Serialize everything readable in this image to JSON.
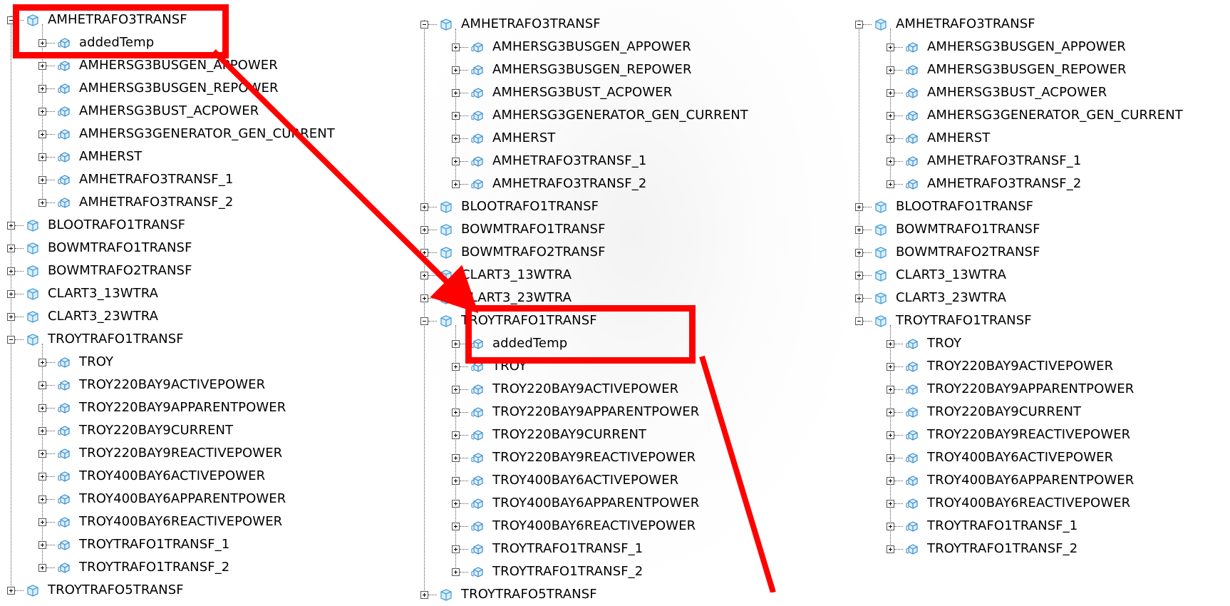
{
  "colors": {
    "highlight": "#ff0000",
    "icon_folder": "#4aa0d8",
    "icon_item": "#3a8ccc"
  },
  "left_panel": {
    "rows": [
      {
        "label": "AMHETRAFO3TRANSF",
        "level": 0,
        "state": "expanded",
        "icon": "cube-folder-icon"
      },
      {
        "label": "addedTemp",
        "level": 1,
        "state": "collapsed",
        "icon": "cube-item-icon"
      },
      {
        "label": "AMHERSG3BUSGEN_APPOWER",
        "level": 1,
        "state": "collapsed",
        "icon": "cube-item-icon"
      },
      {
        "label": "AMHERSG3BUSGEN_REPOWER",
        "level": 1,
        "state": "collapsed",
        "icon": "cube-item-icon"
      },
      {
        "label": "AMHERSG3BUST_ACPOWER",
        "level": 1,
        "state": "collapsed",
        "icon": "cube-item-icon"
      },
      {
        "label": "AMHERSG3GENERATOR_GEN_CURRENT",
        "level": 1,
        "state": "collapsed",
        "icon": "cube-item-icon"
      },
      {
        "label": "AMHERST",
        "level": 1,
        "state": "collapsed",
        "icon": "cube-item-icon"
      },
      {
        "label": "AMHETRAFO3TRANSF_1",
        "level": 1,
        "state": "collapsed",
        "icon": "cube-item-icon"
      },
      {
        "label": "AMHETRAFO3TRANSF_2",
        "level": 1,
        "state": "collapsed",
        "icon": "cube-item-icon"
      },
      {
        "label": "BLOOTRAFO1TRANSF",
        "level": 0,
        "state": "collapsed",
        "icon": "cube-folder-icon"
      },
      {
        "label": "BOWMTRAFO1TRANSF",
        "level": 0,
        "state": "collapsed",
        "icon": "cube-folder-icon"
      },
      {
        "label": "BOWMTRAFO2TRANSF",
        "level": 0,
        "state": "collapsed",
        "icon": "cube-folder-icon"
      },
      {
        "label": "CLART3_13WTRA",
        "level": 0,
        "state": "collapsed",
        "icon": "cube-folder-icon"
      },
      {
        "label": "CLART3_23WTRA",
        "level": 0,
        "state": "collapsed",
        "icon": "cube-folder-icon"
      },
      {
        "label": "TROYTRAFO1TRANSF",
        "level": 0,
        "state": "expanded",
        "icon": "cube-folder-icon"
      },
      {
        "label": "TROY",
        "level": 1,
        "state": "collapsed",
        "icon": "cube-item-icon"
      },
      {
        "label": "TROY220BAY9ACTIVEPOWER",
        "level": 1,
        "state": "collapsed",
        "icon": "cube-item-icon"
      },
      {
        "label": "TROY220BAY9APPARENTPOWER",
        "level": 1,
        "state": "collapsed",
        "icon": "cube-item-icon"
      },
      {
        "label": "TROY220BAY9CURRENT",
        "level": 1,
        "state": "collapsed",
        "icon": "cube-item-icon"
      },
      {
        "label": "TROY220BAY9REACTIVEPOWER",
        "level": 1,
        "state": "collapsed",
        "icon": "cube-item-icon"
      },
      {
        "label": "TROY400BAY6ACTIVEPOWER",
        "level": 1,
        "state": "collapsed",
        "icon": "cube-item-icon"
      },
      {
        "label": "TROY400BAY6APPARENTPOWER",
        "level": 1,
        "state": "collapsed",
        "icon": "cube-item-icon"
      },
      {
        "label": "TROY400BAY6REACTIVEPOWER",
        "level": 1,
        "state": "collapsed",
        "icon": "cube-item-icon"
      },
      {
        "label": "TROYTRAFO1TRANSF_1",
        "level": 1,
        "state": "collapsed",
        "icon": "cube-item-icon"
      },
      {
        "label": "TROYTRAFO1TRANSF_2",
        "level": 1,
        "state": "collapsed",
        "icon": "cube-item-icon"
      },
      {
        "label": "TROYTRAFO5TRANSF",
        "level": 0,
        "state": "collapsed",
        "icon": "cube-folder-icon"
      }
    ]
  },
  "middle_panel": {
    "rows": [
      {
        "label": "AMHETRAFO3TRANSF",
        "level": 0,
        "state": "expanded",
        "icon": "cube-folder-icon"
      },
      {
        "label": "AMHERSG3BUSGEN_APPOWER",
        "level": 1,
        "state": "collapsed",
        "icon": "cube-item-icon"
      },
      {
        "label": "AMHERSG3BUSGEN_REPOWER",
        "level": 1,
        "state": "collapsed",
        "icon": "cube-item-icon"
      },
      {
        "label": "AMHERSG3BUST_ACPOWER",
        "level": 1,
        "state": "collapsed",
        "icon": "cube-item-icon"
      },
      {
        "label": "AMHERSG3GENERATOR_GEN_CURRENT",
        "level": 1,
        "state": "collapsed",
        "icon": "cube-item-icon"
      },
      {
        "label": "AMHERST",
        "level": 1,
        "state": "collapsed",
        "icon": "cube-item-icon"
      },
      {
        "label": "AMHETRAFO3TRANSF_1",
        "level": 1,
        "state": "collapsed",
        "icon": "cube-item-icon"
      },
      {
        "label": "AMHETRAFO3TRANSF_2",
        "level": 1,
        "state": "collapsed",
        "icon": "cube-item-icon"
      },
      {
        "label": "BLOOTRAFO1TRANSF",
        "level": 0,
        "state": "collapsed",
        "icon": "cube-folder-icon"
      },
      {
        "label": "BOWMTRAFO1TRANSF",
        "level": 0,
        "state": "collapsed",
        "icon": "cube-folder-icon"
      },
      {
        "label": "BOWMTRAFO2TRANSF",
        "level": 0,
        "state": "collapsed",
        "icon": "cube-folder-icon"
      },
      {
        "label": "CLART3_13WTRA",
        "level": 0,
        "state": "collapsed",
        "icon": "cube-folder-icon"
      },
      {
        "label": "CLART3_23WTRA",
        "level": 0,
        "state": "collapsed",
        "icon": "cube-folder-icon"
      },
      {
        "label": "TROYTRAFO1TRANSF",
        "level": 0,
        "state": "expanded",
        "icon": "cube-folder-icon"
      },
      {
        "label": "addedTemp",
        "level": 1,
        "state": "collapsed",
        "icon": "cube-item-icon"
      },
      {
        "label": "TROY",
        "level": 1,
        "state": "collapsed",
        "icon": "cube-item-icon"
      },
      {
        "label": "TROY220BAY9ACTIVEPOWER",
        "level": 1,
        "state": "collapsed",
        "icon": "cube-item-icon"
      },
      {
        "label": "TROY220BAY9APPARENTPOWER",
        "level": 1,
        "state": "collapsed",
        "icon": "cube-item-icon"
      },
      {
        "label": "TROY220BAY9CURRENT",
        "level": 1,
        "state": "collapsed",
        "icon": "cube-item-icon"
      },
      {
        "label": "TROY220BAY9REACTIVEPOWER",
        "level": 1,
        "state": "collapsed",
        "icon": "cube-item-icon"
      },
      {
        "label": "TROY400BAY6ACTIVEPOWER",
        "level": 1,
        "state": "collapsed",
        "icon": "cube-item-icon"
      },
      {
        "label": "TROY400BAY6APPARENTPOWER",
        "level": 1,
        "state": "collapsed",
        "icon": "cube-item-icon"
      },
      {
        "label": "TROY400BAY6REACTIVEPOWER",
        "level": 1,
        "state": "collapsed",
        "icon": "cube-item-icon"
      },
      {
        "label": "TROYTRAFO1TRANSF_1",
        "level": 1,
        "state": "collapsed",
        "icon": "cube-item-icon"
      },
      {
        "label": "TROYTRAFO1TRANSF_2",
        "level": 1,
        "state": "collapsed",
        "icon": "cube-item-icon"
      },
      {
        "label": "TROYTRAFO5TRANSF",
        "level": 0,
        "state": "collapsed",
        "icon": "cube-folder-icon"
      }
    ]
  },
  "right_panel": {
    "rows": [
      {
        "label": "AMHETRAFO3TRANSF",
        "level": 0,
        "state": "expanded",
        "icon": "cube-folder-icon"
      },
      {
        "label": "AMHERSG3BUSGEN_APPOWER",
        "level": 1,
        "state": "collapsed",
        "icon": "cube-item-icon"
      },
      {
        "label": "AMHERSG3BUSGEN_REPOWER",
        "level": 1,
        "state": "collapsed",
        "icon": "cube-item-icon"
      },
      {
        "label": "AMHERSG3BUST_ACPOWER",
        "level": 1,
        "state": "collapsed",
        "icon": "cube-item-icon"
      },
      {
        "label": "AMHERSG3GENERATOR_GEN_CURRENT",
        "level": 1,
        "state": "collapsed",
        "icon": "cube-item-icon"
      },
      {
        "label": "AMHERST",
        "level": 1,
        "state": "collapsed",
        "icon": "cube-item-icon"
      },
      {
        "label": "AMHETRAFO3TRANSF_1",
        "level": 1,
        "state": "collapsed",
        "icon": "cube-item-icon"
      },
      {
        "label": "AMHETRAFO3TRANSF_2",
        "level": 1,
        "state": "collapsed",
        "icon": "cube-item-icon"
      },
      {
        "label": "BLOOTRAFO1TRANSF",
        "level": 0,
        "state": "collapsed",
        "icon": "cube-folder-icon"
      },
      {
        "label": "BOWMTRAFO1TRANSF",
        "level": 0,
        "state": "collapsed",
        "icon": "cube-folder-icon"
      },
      {
        "label": "BOWMTRAFO2TRANSF",
        "level": 0,
        "state": "collapsed",
        "icon": "cube-folder-icon"
      },
      {
        "label": "CLART3_13WTRA",
        "level": 0,
        "state": "collapsed",
        "icon": "cube-folder-icon"
      },
      {
        "label": "CLART3_23WTRA",
        "level": 0,
        "state": "collapsed",
        "icon": "cube-folder-icon"
      },
      {
        "label": "TROYTRAFO1TRANSF",
        "level": 0,
        "state": "expanded",
        "icon": "cube-folder-icon"
      },
      {
        "label": "TROY",
        "level": 1,
        "state": "collapsed",
        "icon": "cube-item-icon"
      },
      {
        "label": "TROY220BAY9ACTIVEPOWER",
        "level": 1,
        "state": "collapsed",
        "icon": "cube-item-icon"
      },
      {
        "label": "TROY220BAY9APPARENTPOWER",
        "level": 1,
        "state": "collapsed",
        "icon": "cube-item-icon"
      },
      {
        "label": "TROY220BAY9CURRENT",
        "level": 1,
        "state": "collapsed",
        "icon": "cube-item-icon"
      },
      {
        "label": "TROY220BAY9REACTIVEPOWER",
        "level": 1,
        "state": "collapsed",
        "icon": "cube-item-icon"
      },
      {
        "label": "TROY400BAY6ACTIVEPOWER",
        "level": 1,
        "state": "collapsed",
        "icon": "cube-item-icon"
      },
      {
        "label": "TROY400BAY6APPARENTPOWER",
        "level": 1,
        "state": "collapsed",
        "icon": "cube-item-icon"
      },
      {
        "label": "TROY400BAY6REACTIVEPOWER",
        "level": 1,
        "state": "collapsed",
        "icon": "cube-item-icon"
      },
      {
        "label": "TROYTRAFO1TRANSF_1",
        "level": 1,
        "state": "collapsed",
        "icon": "cube-item-icon"
      },
      {
        "label": "TROYTRAFO1TRANSF_2",
        "level": 1,
        "state": "collapsed",
        "icon": "cube-item-icon"
      }
    ]
  }
}
